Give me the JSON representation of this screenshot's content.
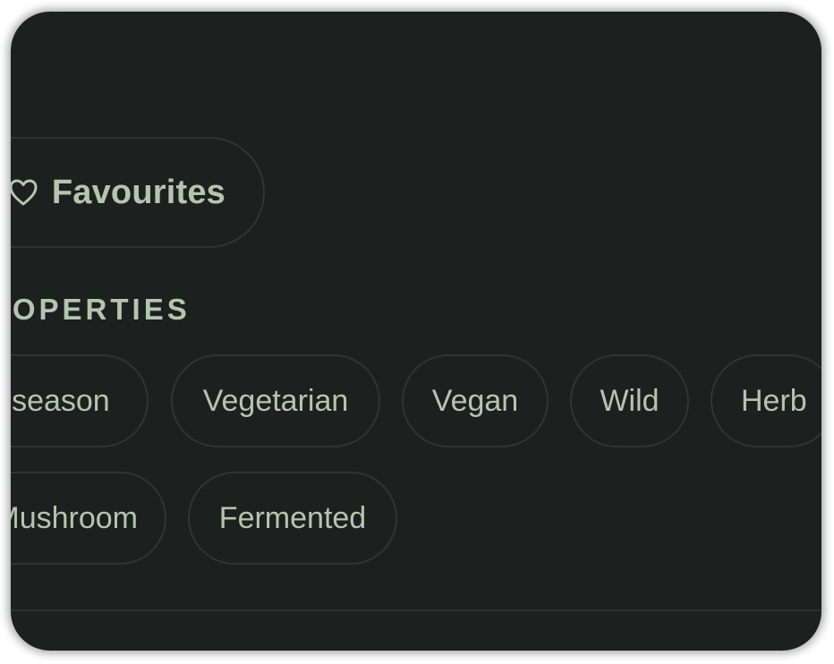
{
  "favourites": {
    "label": "Favourites",
    "icon": "heart-icon"
  },
  "properties": {
    "section_title": "PROPERTIES",
    "chips_row1": [
      "In season",
      "Vegetarian",
      "Vegan",
      "Wild",
      "Herb"
    ],
    "chips_row2": [
      "Mushroom",
      "Fermented"
    ]
  },
  "colors": {
    "background": "#1c201f",
    "text": "#b4c5ae",
    "chip_border": "#2f3533"
  }
}
